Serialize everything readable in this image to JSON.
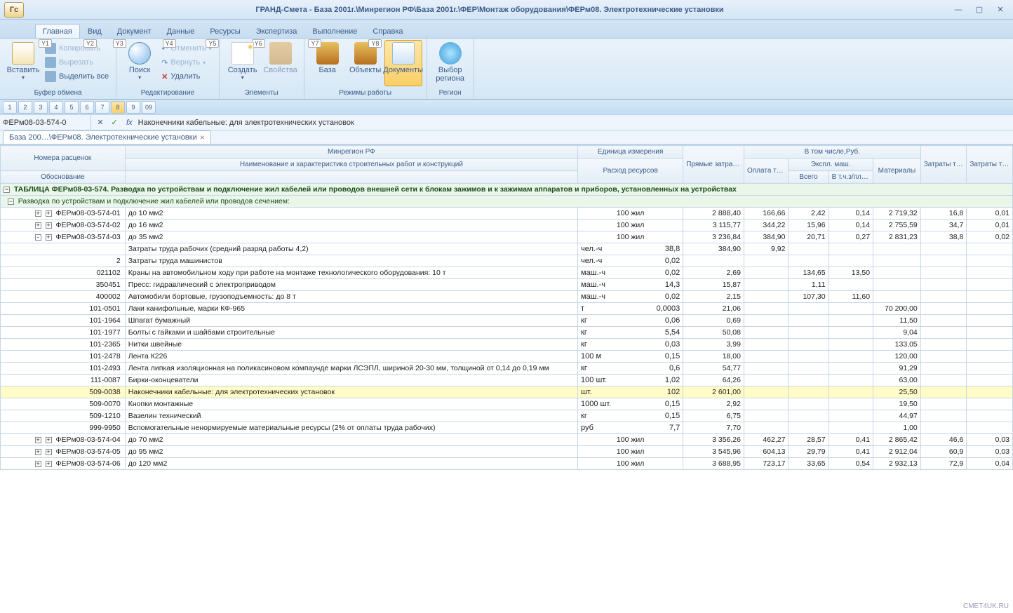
{
  "title": "ГРАНД-Смета - База 2001г.\\Минрегион РФ\\База 2001г.\\ФЕР\\Монтаж оборудования\\ФЕРм08. Электротехнические установки",
  "ribbonTabs": [
    {
      "label": "Главная",
      "hint": "Y1",
      "active": true
    },
    {
      "label": "Вид",
      "hint": "Y2"
    },
    {
      "label": "Документ",
      "hint": "Y3"
    },
    {
      "label": "Данные",
      "hint": "Y4"
    },
    {
      "label": "Ресурсы",
      "hint": "Y5"
    },
    {
      "label": "Экспертиза",
      "hint": "Y6"
    },
    {
      "label": "Выполнение",
      "hint": "Y7"
    },
    {
      "label": "Справка",
      "hint": "Y8"
    }
  ],
  "ribbon": {
    "clipboard": {
      "title": "Буфер обмена",
      "paste": "Вставить",
      "copy": "Копировать",
      "cut": "Вырезать",
      "selectAll": "Выделить все"
    },
    "editing": {
      "title": "Редактирование",
      "search": "Поиск",
      "undo": "Отменить",
      "redo": "Вернуть",
      "delete": "Удалить"
    },
    "elements": {
      "title": "Элементы",
      "create": "Создать",
      "props": "Свойства"
    },
    "modes": {
      "title": "Режимы работы",
      "base": "База",
      "objects": "Объекты",
      "documents": "Документы"
    },
    "region": {
      "title": "Регион",
      "choose": "Выбор",
      "choose2": "региона"
    }
  },
  "qat": [
    "1",
    "2",
    "3",
    "4",
    "5",
    "6",
    "7",
    "8",
    "9",
    "09"
  ],
  "formula": {
    "name": "ФЕРм08-03-574-0",
    "value": "Наконечники кабельные: для электротехнических установок"
  },
  "docTab": "База 200…\\ФЕРм08. Электротехнические установки",
  "headers": {
    "rates": "Номера расценок",
    "basis": "Обоснование",
    "ministry": "Минрегион РФ",
    "workName": "Наименование и характеристика строительных работ и конструкций",
    "unit": "Единица измерения",
    "consumption": "Расход ресурсов",
    "direct": "Прямые затраты, Руб.",
    "including": "В том числе,Руб.",
    "wages": "Оплата труда рабочих",
    "machines": "Экспл. маш.",
    "total": "Всего",
    "drivers": "В т.ч.з/пл маш-тов",
    "materials": "Материалы",
    "laborW": "Затраты труда рабочих",
    "laborM": "Затраты труда маш-стов"
  },
  "sectionTitle": "ТАБЛИЦА ФЕРм08-03-574. Разводка по устройствам и подключение жил кабелей или проводов внешней сети к блокам зажимов и к зажимам аппаратов и приборов, установленных на устройствах",
  "subsectionTitle": "Разводка по устройствам и подключение жил кабелей или проводов сечением:",
  "rows": [
    {
      "toggle": "+",
      "code": "ФЕРм08-03-574-01",
      "name": "до 10 мм2",
      "unit": "100 жил",
      "direct": "2 888,40",
      "wages": "166,66",
      "mtotal": "2,42",
      "mdrv": "0,14",
      "mat": "2 719,32",
      "lw": "16,8",
      "lm": "0,01"
    },
    {
      "toggle": "+",
      "code": "ФЕРм08-03-574-02",
      "name": "до 16 мм2",
      "unit": "100 жил",
      "direct": "3 115,77",
      "wages": "344,22",
      "mtotal": "15,96",
      "mdrv": "0,14",
      "mat": "2 755,59",
      "lw": "34,7",
      "lm": "0,01"
    },
    {
      "toggle": "-",
      "code": "ФЕРм08-03-574-03",
      "name": "до 35 мм2",
      "unit": "100 жил",
      "direct": "3 236,84",
      "wages": "384,90",
      "mtotal": "20,71",
      "mdrv": "0,27",
      "mat": "2 831,23",
      "lw": "38,8",
      "lm": "0,02"
    },
    {
      "sub": true,
      "code": "",
      "name": "Затраты труда рабочих (средний разряд работы 4,2)",
      "unit": "чел.-ч",
      "cons": "38,8",
      "direct": "384,90",
      "wages": "9,92"
    },
    {
      "sub": true,
      "code": "2",
      "name": "Затраты труда машинистов",
      "unit": "чел.-ч",
      "cons": "0,02"
    },
    {
      "sub": true,
      "code": "021102",
      "name": "Краны на автомобильном ходу при работе на монтаже технологического оборудования: 10 т",
      "unit": "маш.-ч",
      "cons": "0,02",
      "direct": "2,69",
      "mtotal": "134,65",
      "mdrv": "13,50"
    },
    {
      "sub": true,
      "code": "350451",
      "name": "Пресс: гидравлический с электроприводом",
      "unit": "маш.-ч",
      "cons": "14,3",
      "direct": "15,87",
      "mtotal": "1,11"
    },
    {
      "sub": true,
      "code": "400002",
      "name": "Автомобили бортовые, грузоподъемность: до 8 т",
      "unit": "маш.-ч",
      "cons": "0,02",
      "direct": "2,15",
      "mtotal": "107,30",
      "mdrv": "11,60"
    },
    {
      "sub": true,
      "code": "101-0501",
      "name": "Лаки канифольные, марки КФ-965",
      "unit": "т",
      "cons": "0,0003",
      "direct": "21,06",
      "mat": "70 200,00"
    },
    {
      "sub": true,
      "code": "101-1964",
      "name": "Шпагат бумажный",
      "unit": "кг",
      "cons": "0,06",
      "direct": "0,69",
      "mat": "11,50"
    },
    {
      "sub": true,
      "code": "101-1977",
      "name": "Болты с гайками и шайбами строительные",
      "unit": "кг",
      "cons": "5,54",
      "direct": "50,08",
      "mat": "9,04"
    },
    {
      "sub": true,
      "code": "101-2365",
      "name": "Нитки швейные",
      "unit": "кг",
      "cons": "0,03",
      "direct": "3,99",
      "mat": "133,05"
    },
    {
      "sub": true,
      "code": "101-2478",
      "name": "Лента К226",
      "unit": "100 м",
      "cons": "0,15",
      "direct": "18,00",
      "mat": "120,00"
    },
    {
      "sub": true,
      "code": "101-2493",
      "name": "Лента липкая изоляционная на поликасиновом компаунде марки ЛСЭПЛ, шириной 20-30 мм, толщиной от 0,14 до 0,19 мм",
      "unit": "кг",
      "cons": "0,6",
      "direct": "54,77",
      "mat": "91,29"
    },
    {
      "sub": true,
      "code": "111-0087",
      "name": "Бирки-оконцеватели",
      "unit": "100 шт.",
      "cons": "1,02",
      "direct": "64,26",
      "mat": "63,00"
    },
    {
      "sub": true,
      "hl": true,
      "code": "509-0038",
      "name": "Наконечники кабельные: для электротехнических установок",
      "unit": "шт.",
      "cons": "102",
      "direct": "2 601,00",
      "mat": "25,50"
    },
    {
      "sub": true,
      "code": "509-0070",
      "name": "Кнопки монтажные",
      "unit": "1000 шт.",
      "cons": "0,15",
      "direct": "2,92",
      "mat": "19,50"
    },
    {
      "sub": true,
      "code": "509-1210",
      "name": "Вазелин технический",
      "unit": "кг",
      "cons": "0,15",
      "direct": "6,75",
      "mat": "44,97"
    },
    {
      "sub": true,
      "code": "999-9950",
      "name": "Вспомогательные ненормируемые материальные ресурсы (2% от оплаты труда рабочих)",
      "unit": "руб",
      "cons": "7,7",
      "direct": "7,70",
      "mat": "1,00"
    },
    {
      "toggle": "+",
      "code": "ФЕРм08-03-574-04",
      "name": "до 70 мм2",
      "unit": "100 жил",
      "direct": "3 356,26",
      "wages": "462,27",
      "mtotal": "28,57",
      "mdrv": "0,41",
      "mat": "2 865,42",
      "lw": "46,6",
      "lm": "0,03"
    },
    {
      "toggle": "+",
      "code": "ФЕРм08-03-574-05",
      "name": "до 95 мм2",
      "unit": "100 жил",
      "direct": "3 545,96",
      "wages": "604,13",
      "mtotal": "29,79",
      "mdrv": "0,41",
      "mat": "2 912,04",
      "lw": "60,9",
      "lm": "0,03"
    },
    {
      "toggle": "+",
      "code": "ФЕРм08-03-574-06",
      "name": "до 120 мм2",
      "unit": "100 жил",
      "direct": "3 688,95",
      "wages": "723,17",
      "mtotal": "33,65",
      "mdrv": "0,54",
      "mat": "2 932,13",
      "lw": "72,9",
      "lm": "0,04"
    }
  ],
  "watermark": "CMET4UK.RU"
}
